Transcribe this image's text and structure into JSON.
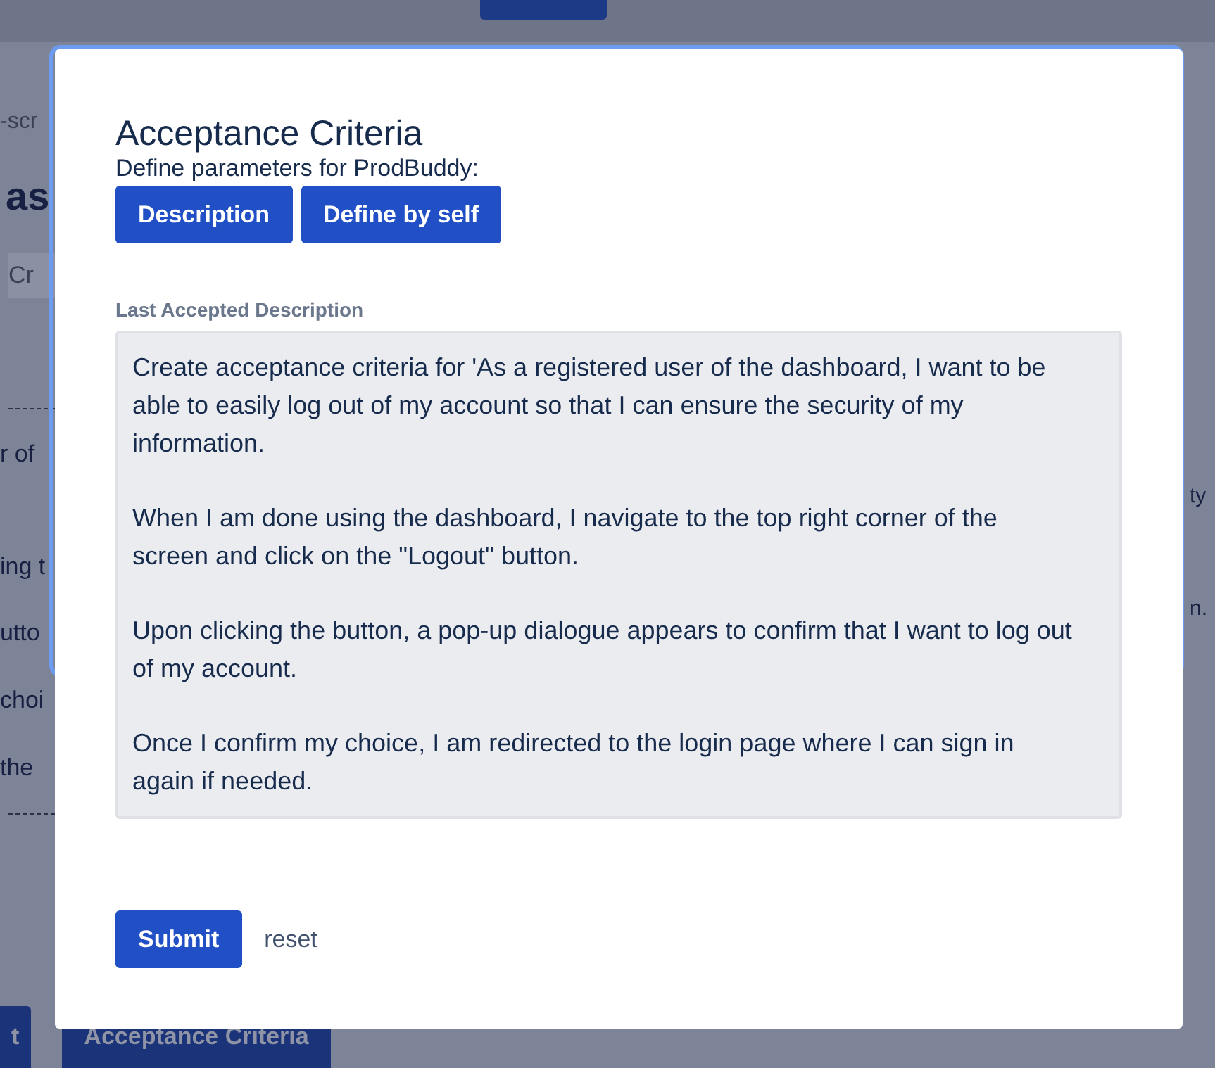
{
  "background": {
    "left_fragments": [
      {
        "kind": "caption",
        "text": "-scr"
      },
      {
        "kind": "heading",
        "text": "as"
      },
      {
        "kind": "field",
        "text": "Cr"
      },
      {
        "kind": "rule"
      },
      {
        "kind": "text",
        "text": "r of"
      },
      {
        "kind": "text",
        "text": "ing t"
      },
      {
        "kind": "text",
        "text": "utto"
      },
      {
        "kind": "text",
        "text": "choi"
      },
      {
        "kind": "text",
        "text": "the"
      },
      {
        "kind": "rule"
      }
    ],
    "right_fragments": [
      "ty",
      "n."
    ],
    "bottom_buttons": [
      "t",
      "Acceptance Criteria"
    ]
  },
  "modal": {
    "title": "Acceptance Criteria",
    "subtitle": "Define parameters for ProdBuddy:",
    "option_buttons": [
      "Description",
      "Define by self"
    ],
    "description_label": "Last Accepted Description",
    "description": [
      "Create acceptance criteria for 'As a registered user of the dashboard, I want to be able to easily log out of my account so that I can ensure the security of my information.",
      "When I am done using the dashboard, I navigate to the top right corner of the screen and click on the \"Logout\" button.",
      "Upon clicking the button, a pop-up dialogue appears to confirm that I want to log out of my account.",
      "Once I confirm my choice, I am redirected to the login page where I can sign in again if needed."
    ],
    "submit": "Submit",
    "reset": "reset"
  }
}
